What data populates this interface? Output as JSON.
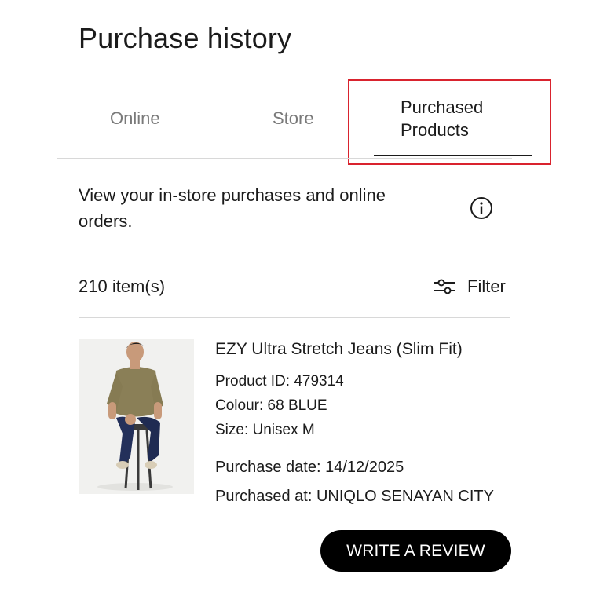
{
  "header": {
    "title": "Purchase history"
  },
  "tabs": [
    {
      "label": "Online",
      "selected": false
    },
    {
      "label": "Store",
      "selected": false
    },
    {
      "label": "Purchased Products",
      "selected": true
    }
  ],
  "highlight_color": "#d9232e",
  "intro": {
    "text": "View your in-store purchases and online orders.",
    "info_icon": "info-icon"
  },
  "list": {
    "count_text": "210 item(s)",
    "filter_label": "Filter",
    "filter_icon": "sliders-icon"
  },
  "product": {
    "name": "EZY Ultra Stretch Jeans (Slim Fit)",
    "product_id": "Product ID: 479314",
    "colour": "Colour: 68 BLUE",
    "size": "Size: Unisex M",
    "purchase_date": "Purchase date: 14/12/2025",
    "purchased_at": "Purchased at: UNIQLO SENAYAN CITY",
    "review_button": "WRITE A REVIEW"
  }
}
